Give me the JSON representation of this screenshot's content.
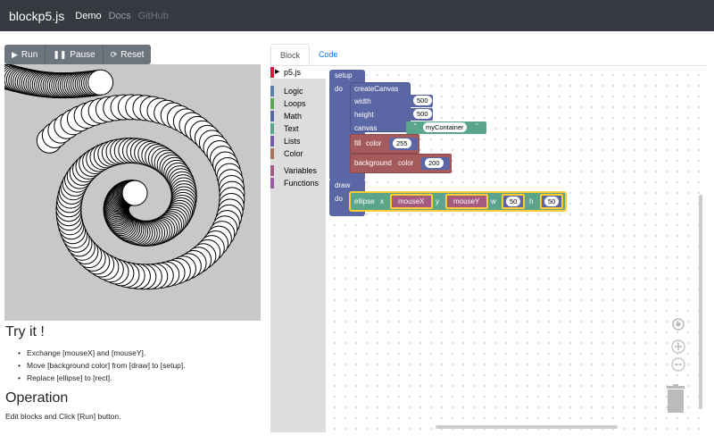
{
  "nav": {
    "brand": "blockp5.js",
    "links": [
      {
        "label": "Demo",
        "state": "active"
      },
      {
        "label": "Docs",
        "state": "muted"
      },
      {
        "label": "GitHub",
        "state": "disabled"
      }
    ]
  },
  "controls": {
    "run_label": "Run",
    "pause_label": "Pause",
    "reset_label": "Reset"
  },
  "help": {
    "try_title": "Try it !",
    "try_items": [
      "Exchange [mouseX] and [mouseY].",
      "Move [background color] from [draw] to [setup].",
      "Replace [ellipse] to [rect]."
    ],
    "op_title": "Operation",
    "op_text": "Edit blocks and Click [Run] button."
  },
  "tabs": [
    {
      "label": "Block",
      "active": true
    },
    {
      "label": "Code",
      "active": false
    }
  ],
  "toolbox": {
    "items": [
      {
        "label": "p5.js",
        "color": "#dc143c",
        "selected": true
      },
      {
        "label": "Logic",
        "color": "#5b80a5"
      },
      {
        "label": "Loops",
        "color": "#5ba55b"
      },
      {
        "label": "Math",
        "color": "#5b67a5"
      },
      {
        "label": "Text",
        "color": "#5ba58c"
      },
      {
        "label": "Lists",
        "color": "#745ba5"
      },
      {
        "label": "Color",
        "color": "#a5745b"
      },
      {
        "label": "Variables",
        "color": "#a55b80"
      },
      {
        "label": "Functions",
        "color": "#995ba5"
      }
    ]
  },
  "blocks": {
    "setup": "setup",
    "do1": "do",
    "createCanvas": "createCanvas",
    "width": "width",
    "width_val": "500",
    "height": "height",
    "height_val": "500",
    "canvas": "canvas",
    "container": "myContainer",
    "quote_open": "“",
    "quote_close": "”",
    "fill": "fill",
    "fill_color": "color",
    "fill_val": "255",
    "background": "background",
    "bg_color": "color",
    "bg_val": "200",
    "draw": "draw",
    "do2": "do",
    "ellipse": "ellipse",
    "x": "x",
    "mouseX": "mouseX",
    "y": "y",
    "mouseY": "mouseY",
    "w": "w",
    "w_val": "50",
    "h": "h",
    "h_val": "50"
  },
  "colors": {
    "procedure": "#5b67a5",
    "text_block": "#5ba58c",
    "color_block": "#a5745b",
    "variable": "#a55b80",
    "math_block": "#5b67a5",
    "navbar": "#343a40"
  },
  "canvas_bg": "#c8c8c8",
  "workspace_controls": [
    "target-icon",
    "zoom-in-icon",
    "zoom-out-icon",
    "trash-icon"
  ]
}
